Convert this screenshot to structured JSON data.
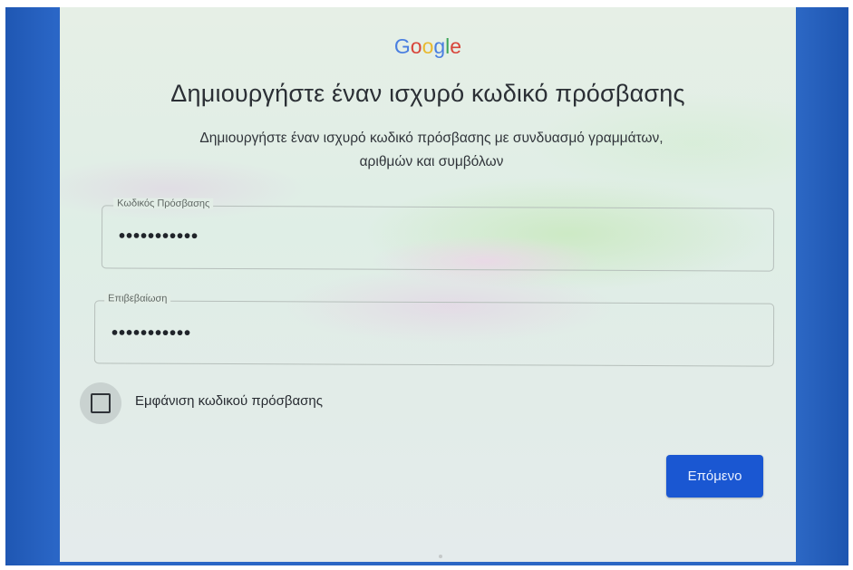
{
  "logo": {
    "letters": [
      {
        "char": "G",
        "color": "#4a7fe0"
      },
      {
        "char": "o",
        "color": "#d8453a"
      },
      {
        "char": "o",
        "color": "#e9b92f"
      },
      {
        "char": "g",
        "color": "#4a7fe0"
      },
      {
        "char": "l",
        "color": "#3ea55a"
      },
      {
        "char": "e",
        "color": "#d8453a"
      }
    ]
  },
  "page": {
    "title": "Δημιουργήστε έναν ισχυρό κωδικό πρόσβασης",
    "subtitle_line1": "Δημιουργήστε έναν ισχυρό κωδικό πρόσβασης με συνδυασμό γραμμάτων,",
    "subtitle_line2": "αριθμών και συμβόλων"
  },
  "password_field": {
    "label": "Κωδικός Πρόσβασης",
    "value": "•••••••••••"
  },
  "confirm_field": {
    "label": "Επιβεβαίωση",
    "value": "•••••••••••"
  },
  "show_password": {
    "label": "Εμφάνιση κωδικού πρόσβασης",
    "checked": false
  },
  "next_button": {
    "label": "Επόμενο",
    "color": "#1a57d2"
  }
}
